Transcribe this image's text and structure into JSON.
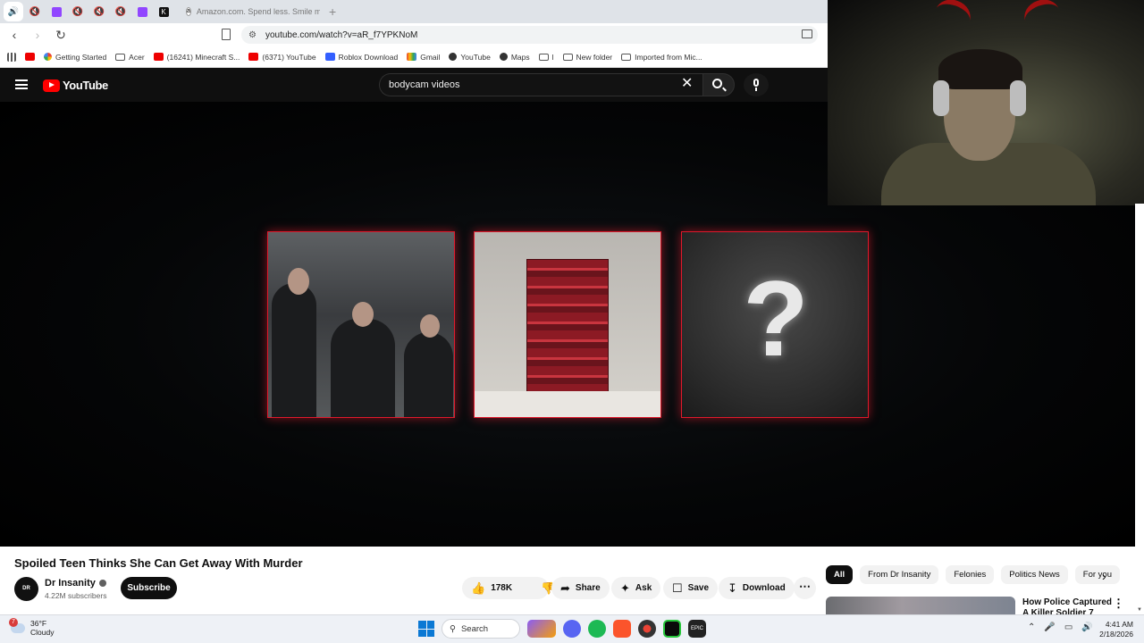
{
  "browser": {
    "tabs": [
      {
        "icon": "speaker-icon"
      },
      {
        "icon": "muted-icon"
      },
      {
        "icon": "twitch-icon"
      },
      {
        "icon": "muted-icon"
      },
      {
        "icon": "muted-icon"
      },
      {
        "icon": "muted-icon"
      },
      {
        "icon": "twitch-icon"
      },
      {
        "icon": "kick-icon"
      }
    ],
    "active_tab_title": "Amazon.com. Spend less. Smile more.",
    "url": "youtube.com/watch?v=aR_f7YPKNoM",
    "bookmarks": [
      {
        "label": "",
        "icon": "youtube-icon"
      },
      {
        "label": "Getting Started",
        "icon": "google-icon"
      },
      {
        "label": "Acer",
        "icon": "folder-icon"
      },
      {
        "label": "(16241) Minecraft S...",
        "icon": "youtube-icon"
      },
      {
        "label": "(6371) YouTube",
        "icon": "youtube-icon"
      },
      {
        "label": "Roblox Download",
        "icon": "roblox-icon"
      },
      {
        "label": "Gmail",
        "icon": "gmail-icon"
      },
      {
        "label": "YouTube",
        "icon": "globe-icon"
      },
      {
        "label": "Maps",
        "icon": "globe-icon"
      },
      {
        "label": "l",
        "icon": "folder-icon"
      },
      {
        "label": "New folder",
        "icon": "folder-icon"
      },
      {
        "label": "Imported from Mic...",
        "icon": "folder-icon"
      }
    ]
  },
  "youtube": {
    "logo_text": "YouTube",
    "search_query": "bodycam videos",
    "video": {
      "question_mark": "?"
    },
    "title": "Spoiled Teen Thinks She Can Get Away With Murder",
    "channel": {
      "name": "Dr Insanity",
      "subscribers": "4.22M subscribers",
      "avatar_text": "DR INSANITY"
    },
    "subscribe_label": "Subscribe",
    "actions": {
      "likes": "178K",
      "share": "Share",
      "ask": "Ask",
      "save": "Save",
      "download": "Download",
      "more": "⋯"
    },
    "chips": [
      "All",
      "From Dr Insanity",
      "Felonies",
      "Politics News",
      "For you"
    ],
    "recommendation": {
      "title": "How Police Captured A Killer Soldier 7"
    }
  },
  "taskbar": {
    "weather_temp": "36°F",
    "weather_desc": "Cloudy",
    "weather_badge": "7",
    "search_label": "Search",
    "time": "4:41 AM",
    "date": "2/18/2026"
  },
  "colors": {
    "accent_red": "#ff0000",
    "panel_border": "#e0192b"
  }
}
